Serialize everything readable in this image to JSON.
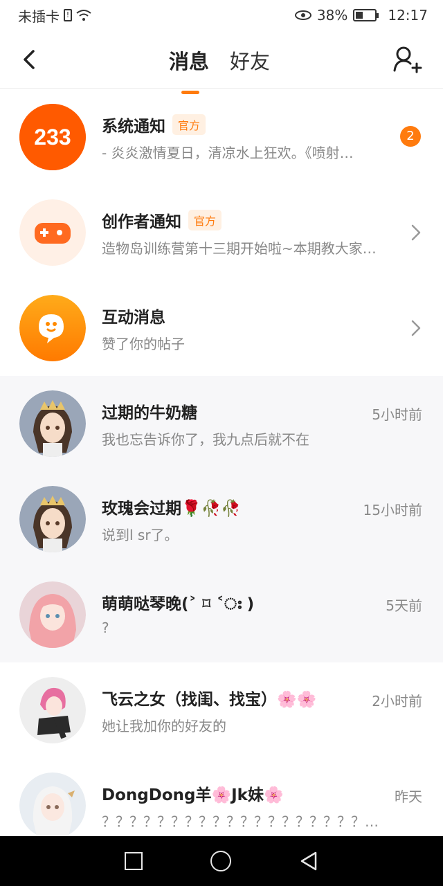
{
  "status_bar": {
    "carrier": "未插卡",
    "battery": "38%",
    "battery_level": 0.38,
    "time": "12:17"
  },
  "header": {
    "tabs": [
      {
        "label": "消息",
        "active": true
      },
      {
        "label": "好友",
        "active": false
      }
    ],
    "icons": {
      "back": "back-arrow-icon",
      "add_friend": "add-friend-icon"
    }
  },
  "colors": {
    "accent": "#ff7b0e",
    "row_grey": "#f7f7f9"
  },
  "messages": [
    {
      "name": "系统通知",
      "tag": "官方",
      "preview": "- 炎炎激情夏日，清凉水上狂欢。《喷射…",
      "unread": "2",
      "avatar": "233-logo-icon"
    },
    {
      "name": "创作者通知",
      "tag": "官方",
      "preview": "造物岛训练营第十三期开始啦~本期教大家…",
      "avatar": "gamepad-icon"
    },
    {
      "name": "互动消息",
      "preview": "赞了你的帖子",
      "avatar": "chat-bubble-icon"
    },
    {
      "name": "过期的牛奶糖",
      "preview": "我也忘告诉你了，我九点后就不在",
      "time": "5小时前",
      "avatar": "anime-avatar"
    },
    {
      "name": "玫瑰会过期🌹🥀🥀",
      "preview": "说到l sr了。",
      "time": "15小时前",
      "avatar": "anime-avatar"
    },
    {
      "name": "萌萌哒琴晚(˃ ⌑ ˂ഃ )",
      "preview": "?",
      "time": "5天前",
      "avatar": "anime-avatar"
    },
    {
      "name": "飞云之女（找闺、找宝）🌸🌸",
      "preview": "她让我加你的好友的",
      "time": "2小时前",
      "avatar": "anime-avatar"
    },
    {
      "name": "DongDong羊🌸Jk妹🌸",
      "preview": "？？？？？？？？？？？？？？？？？？？…",
      "time": "昨天",
      "avatar": "anime-avatar"
    }
  ]
}
